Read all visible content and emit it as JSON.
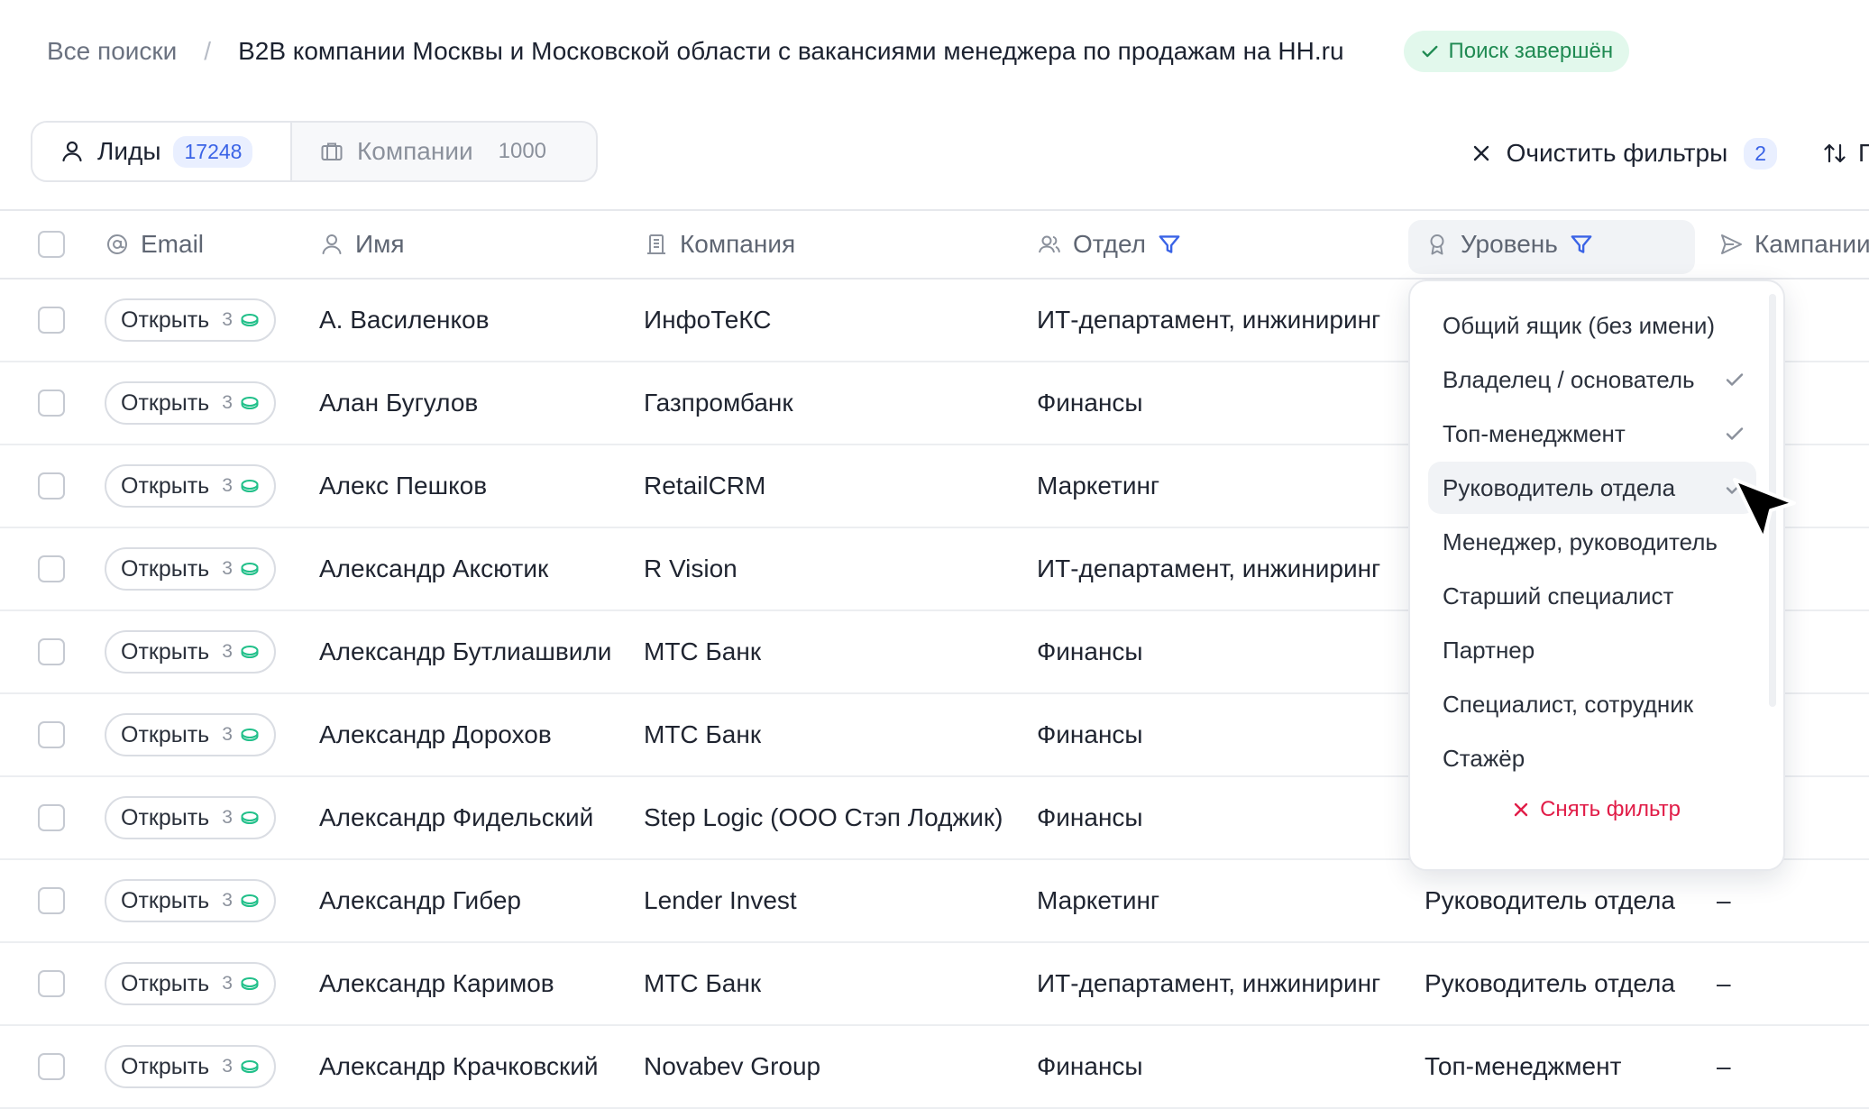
{
  "breadcrumb": {
    "root": "Все поиски",
    "separator": "/",
    "title": "B2B компании Москвы и Московской области с вакансиями менеджера по продажам на HH.ru",
    "status": "Поиск завершён"
  },
  "tabs": [
    {
      "label": "Лиды",
      "count": "17248",
      "active": true
    },
    {
      "label": "Компании",
      "count": "1000",
      "active": false
    }
  ],
  "actions": {
    "clear_filters": "Очистить фильтры",
    "filters_count": "2",
    "sort_label": "П"
  },
  "columns": {
    "email": "Email",
    "name": "Имя",
    "company": "Компания",
    "department": "Отдел",
    "level": "Уровень",
    "campaigns": "Кампании"
  },
  "open_label": "Открыть",
  "open_cost": "3",
  "rows": [
    {
      "name": "А. Василенков",
      "company": "ИнфоТеКС",
      "department": "ИТ-департамент, инжиниринг",
      "level": "",
      "campaigns": ""
    },
    {
      "name": "Алан Бугулов",
      "company": "Газпромбанк",
      "department": "Финансы",
      "level": "",
      "campaigns": ""
    },
    {
      "name": "Алекс Пешков",
      "company": "RetailCRM",
      "department": "Маркетинг",
      "level": "",
      "campaigns": ""
    },
    {
      "name": "Александр Аксютик",
      "company": "R Vision",
      "department": "ИТ-департамент, инжиниринг",
      "level": "",
      "campaigns": ""
    },
    {
      "name": "Александр Бутлиашвили",
      "company": "МТС Банк",
      "department": "Финансы",
      "level": "",
      "campaigns": ""
    },
    {
      "name": "Александр Дорохов",
      "company": "МТС Банк",
      "department": "Финансы",
      "level": "",
      "campaigns": ""
    },
    {
      "name": "Александр Фидельский",
      "company": "Step Logic (ООО Стэп Лоджик)",
      "department": "Финансы",
      "level": "",
      "campaigns": ""
    },
    {
      "name": "Александр Гибер",
      "company": "Lender Invest",
      "department": "Маркетинг",
      "level": "Руководитель отдела",
      "campaigns": "–"
    },
    {
      "name": "Александр Каримов",
      "company": "МТС Банк",
      "department": "ИТ-департамент, инжиниринг",
      "level": "Руководитель отдела",
      "campaigns": "–"
    },
    {
      "name": "Александр Крачковский",
      "company": "Novabev Group",
      "department": "Финансы",
      "level": "Топ-менеджмент",
      "campaigns": "–"
    }
  ],
  "level_filter": {
    "options": [
      {
        "label": "Общий ящик (без имени)",
        "checked": false
      },
      {
        "label": "Владелец / основатель",
        "checked": true
      },
      {
        "label": "Топ-менеджмент",
        "checked": true
      },
      {
        "label": "Руководитель отдела",
        "checked": true
      },
      {
        "label": "Менеджер, руководитель",
        "checked": false
      },
      {
        "label": "Старший специалист",
        "checked": false
      },
      {
        "label": "Партнер",
        "checked": false
      },
      {
        "label": "Специалист, сотрудник",
        "checked": false
      },
      {
        "label": "Стажёр",
        "checked": false
      }
    ],
    "hovered_option": "Руководитель отдела",
    "remove_filter": "Снять фильтр"
  },
  "colors": {
    "accent_blue": "#3a63e6",
    "success_green": "#1f8a52",
    "danger_red": "#e11d48",
    "coin_green": "#22c08a"
  }
}
